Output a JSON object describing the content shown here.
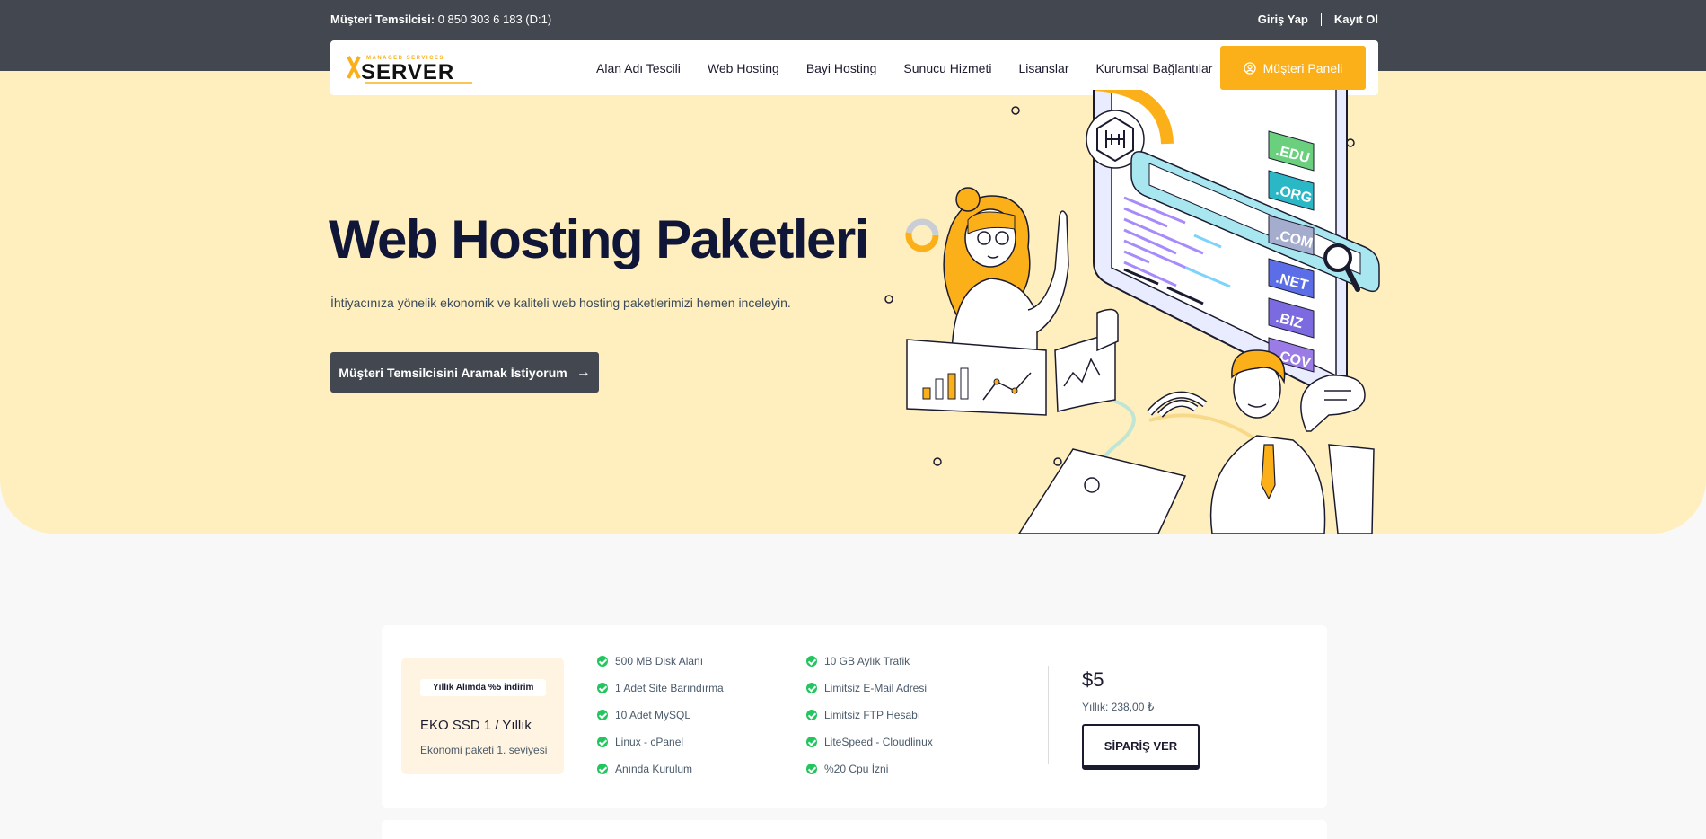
{
  "topbar": {
    "phone_label": "Müşteri Temsilcisi:",
    "phone_number": "0 850 303 6 183 (D:1)",
    "login": "Giriş Yap",
    "register": "Kayıt Ol"
  },
  "logo": {
    "top_text": "MANAGED SERVICES",
    "main_text": "SERVER"
  },
  "nav": {
    "items": [
      "Alan Adı Tescili",
      "Web Hosting",
      "Bayi Hosting",
      "Sunucu Hizmeti",
      "Lisanslar",
      "Kurumsal Bağlantılar"
    ],
    "panel_button": "Müşteri Paneli"
  },
  "hero": {
    "title": "Web Hosting Paketleri",
    "subtitle": "İhtiyacınıza yönelik ekonomik ve kaliteli web hosting paketlerimizi hemen inceleyin.",
    "cta": "Müşteri Temsilcisini Aramak İstiyorum",
    "domain_tags": [
      ".EDU",
      ".ORG",
      ".COM",
      ".NET",
      ".BIZ",
      ".COV"
    ]
  },
  "package": {
    "badge": "Yıllık Alımda %5 indirim",
    "name": "EKO SSD 1 / Yıllık",
    "description": "Ekonomi paketi 1. seviyesi",
    "features_col1": [
      "500 MB Disk Alanı",
      "1 Adet Site Barındırma",
      "10 Adet MySQL",
      "Linux - cPanel",
      "Anında Kurulum"
    ],
    "features_col2": [
      "10 GB Aylık Trafik",
      "Limitsiz E-Mail Adresi",
      "Limitsiz FTP Hesabı",
      "LiteSpeed - Cloudlinux",
      "%20 Cpu İzni"
    ],
    "price": "$5",
    "yearly": "Yıllık: 238,00 ₺",
    "order_button": "SİPARİŞ VER"
  },
  "colors": {
    "accent": "#fbb01a",
    "dark": "#434850",
    "hero_bg": "#ffefbe",
    "check": "#22c55e"
  }
}
